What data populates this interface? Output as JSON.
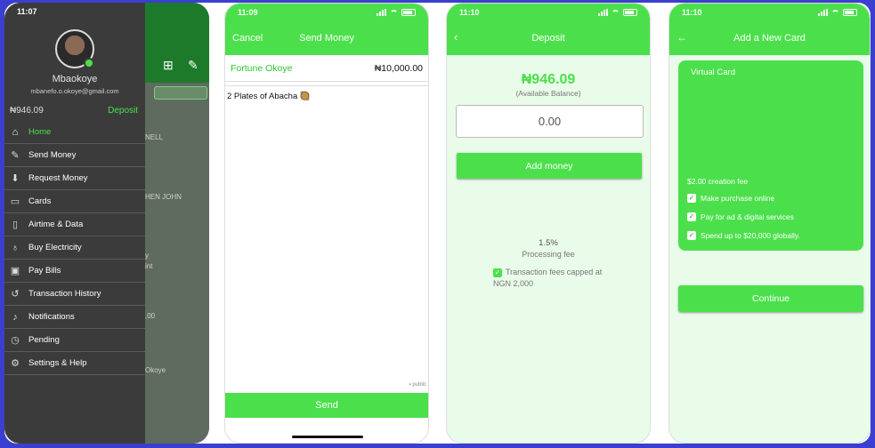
{
  "screen1": {
    "status_time": "11:07",
    "username": "Mbaokoye",
    "email": "mbanefo.o.okoye@gmail.com",
    "balance": "₦946.09",
    "deposit_label": "Deposit",
    "menu": [
      {
        "label": "Home",
        "icon": "home-icon"
      },
      {
        "label": "Send Money",
        "icon": "edit-icon"
      },
      {
        "label": "Request Money",
        "icon": "inbox-icon"
      },
      {
        "label": "Cards",
        "icon": "card-icon"
      },
      {
        "label": "Airtime & Data",
        "icon": "phone-icon"
      },
      {
        "label": "Buy Electricity",
        "icon": "bulb-icon"
      },
      {
        "label": "Pay Bills",
        "icon": "cash-icon"
      },
      {
        "label": "Transaction History",
        "icon": "history-icon"
      },
      {
        "label": "Notifications",
        "icon": "bell-icon"
      },
      {
        "label": "Pending",
        "icon": "pending-icon"
      },
      {
        "label": "Settings & Help",
        "icon": "gear-icon"
      }
    ],
    "background_fragments": [
      "NELL",
      "HEN JOHN",
      "y",
      "int",
      ",00",
      "Okoye"
    ]
  },
  "screen2": {
    "status_time": "11:09",
    "cancel_label": "Cancel",
    "title": "Send Money",
    "recipient_name": "Fortune Okoye",
    "amount": "₦10,000.00",
    "note": "2 Plates of Abacha 🥘",
    "privacy": "public",
    "send_label": "Send"
  },
  "screen3": {
    "status_time": "11:10",
    "title": "Deposit",
    "balance": "₦946.09",
    "balance_label": "(Available Balance)",
    "amount_value": "0.00",
    "add_money_label": "Add money",
    "fee_percent": "1.5%",
    "fee_label": "Processing fee",
    "cap_text": "Transaction fees capped at NGN 2,000"
  },
  "screen4": {
    "status_time": "11:10",
    "title": "Add a New Card",
    "card_title": "Virtual Card",
    "creation_fee": "$2.00 creation fee",
    "features": [
      "Make purchase online",
      "Pay for ad & digital services",
      "Spend up to $20,000 globally."
    ],
    "continue_label": "Continue"
  },
  "colors": {
    "accent": "#4be04b",
    "frame": "#3a3fd0",
    "drawer": "#3b3b3b"
  }
}
